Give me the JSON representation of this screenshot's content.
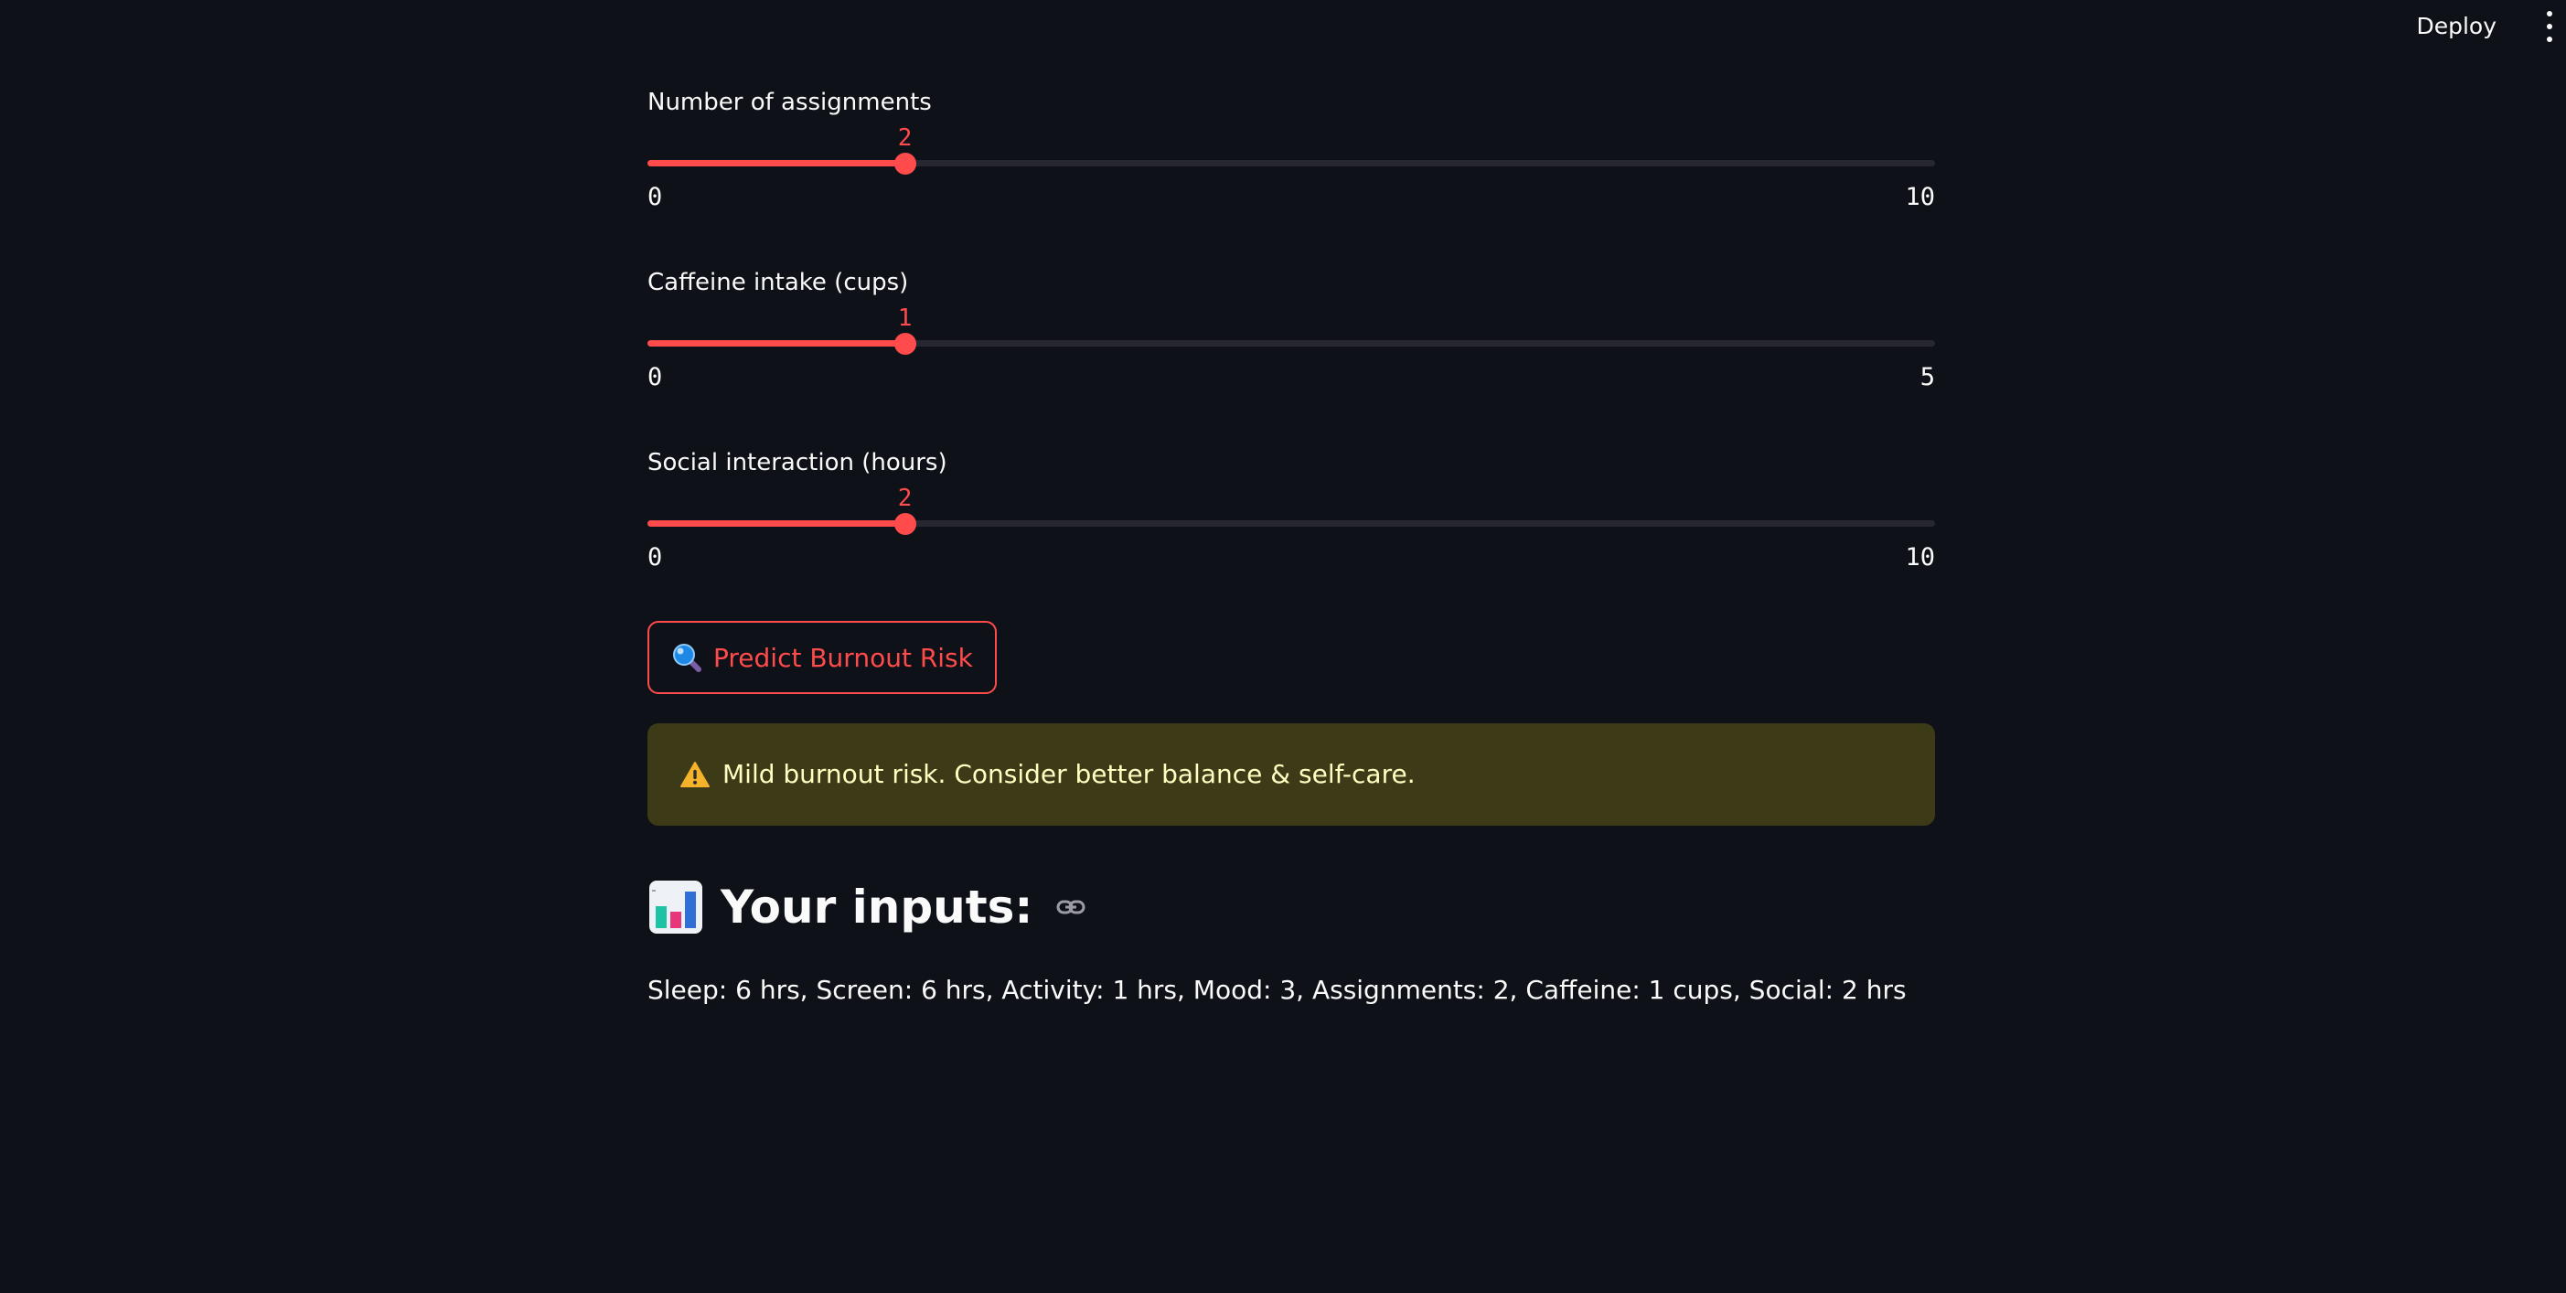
{
  "header": {
    "deploy_label": "Deploy",
    "menu_icon": "vertical-ellipsis-icon"
  },
  "sliders": [
    {
      "label": "Number of assignments",
      "value": "2",
      "min": "0",
      "max": "10",
      "fraction": 0.2
    },
    {
      "label": "Caffeine intake (cups)",
      "value": "1",
      "min": "0",
      "max": "5",
      "fraction": 0.2
    },
    {
      "label": "Social interaction (hours)",
      "value": "2",
      "min": "0",
      "max": "10",
      "fraction": 0.2
    }
  ],
  "predict_button": {
    "icon": "magnifying-glass-icon",
    "label": "Predict Burnout Risk"
  },
  "alert": {
    "icon": "warning-icon",
    "text": "Mild burnout risk. Consider better balance & self-care."
  },
  "inputs_section": {
    "icon": "bar-chart-icon",
    "heading": "Your inputs:",
    "anchor_icon": "link-icon",
    "summary": "Sleep: 6 hrs, Screen: 6 hrs, Activity: 1 hrs, Mood: 3, Assignments: 2, Caffeine: 1 cups, Social: 2 hrs"
  },
  "colors": {
    "background": "#0e1117",
    "accent": "#ff4b4b",
    "track": "#262730",
    "warning_bg": "#3d3a17",
    "warning_text": "#ffffc2"
  }
}
